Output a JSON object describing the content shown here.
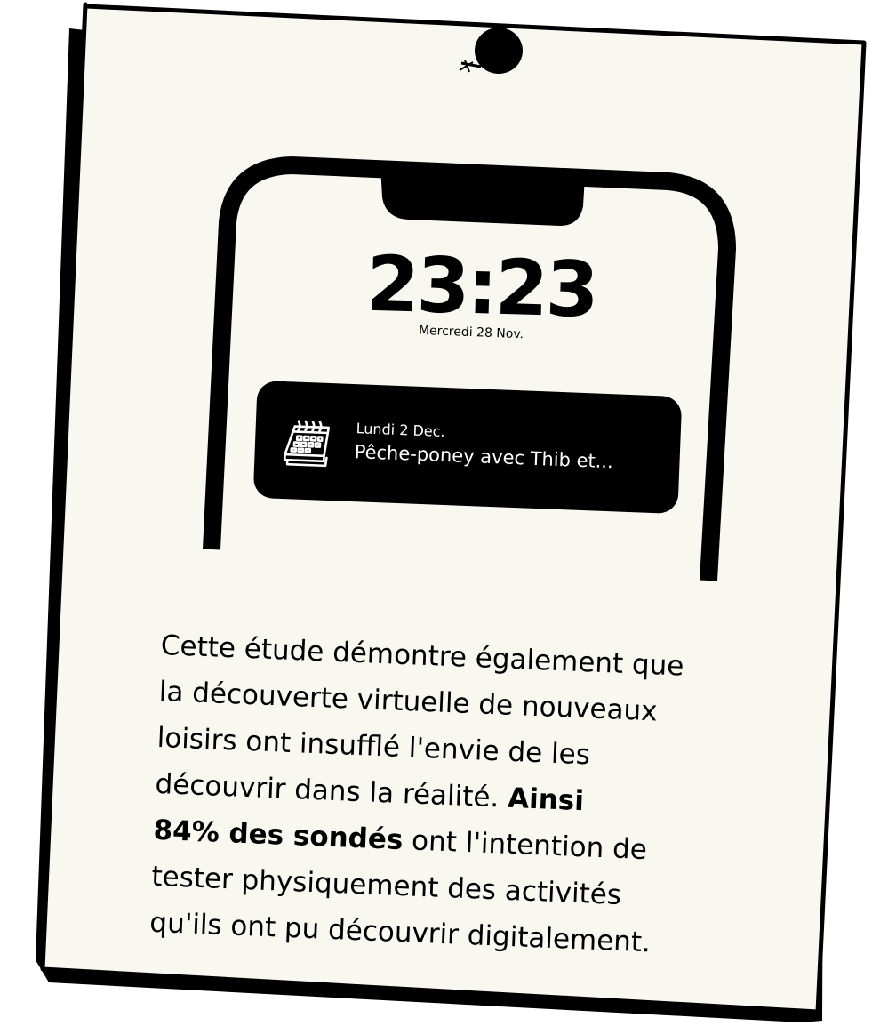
{
  "phone": {
    "time": "23:23",
    "date": "Mercredi 28 Nov."
  },
  "notification": {
    "icon": "calendar-icon",
    "date": "Lundi 2 Dec.",
    "title": "Pêche-poney avec Thib et..."
  },
  "body": {
    "line1": "Cette étude démontre également que",
    "line2": "la découverte virtuelle de nouveaux",
    "line3": "loisirs ont insufflé l'envie de les",
    "line4_plain": "découvrir dans la réalité. ",
    "line4_bold": "Ainsi",
    "line5_bold": "84% des sondés",
    "line5_plain": " ont l'intention de",
    "line6": "tester physiquement des activités",
    "line7": "qu'ils ont pu découvrir digitalement."
  },
  "colors": {
    "paper": "#f8f8f1",
    "ink": "#000000"
  }
}
